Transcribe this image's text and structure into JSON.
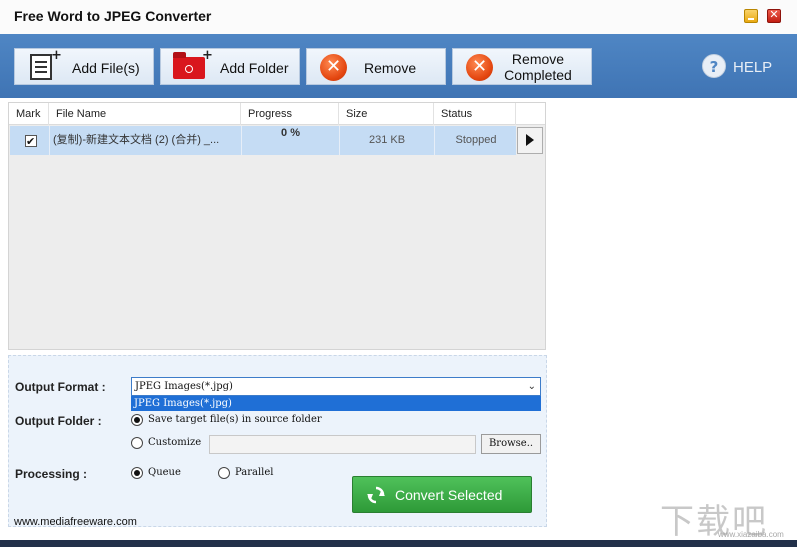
{
  "window": {
    "title": "Free Word to JPEG Converter",
    "close_glyph": "✕"
  },
  "toolbar": {
    "add_files": "Add File(s)",
    "add_folder": "Add Folder",
    "remove": "Remove",
    "remove_completed_line1": "Remove",
    "remove_completed_line2": "Completed",
    "help": "HELP",
    "help_glyph": "?",
    "x_glyph": "✕",
    "plus_glyph": "+"
  },
  "list": {
    "columns": [
      "Mark",
      "File Name",
      "Progress",
      "Size",
      "Status"
    ],
    "rows": [
      {
        "checked_glyph": "✔",
        "file_name": "(复制)-新建文本文档 (2) (合并) _...",
        "progress": "0 %",
        "size": "231 KB",
        "status": "Stopped"
      }
    ]
  },
  "options": {
    "output_format_label": "Output Format :",
    "output_format_value": "JPEG Images(*.jpg)",
    "dropdown_option": "JPEG Images(*.jpg)",
    "chevron_glyph": "⌄",
    "output_folder_label": "Output Folder :",
    "save_in_source": "Save target file(s) in source folder",
    "customize": "Customize",
    "browse": "Browse..",
    "processing_label": "Processing :",
    "queue": "Queue",
    "parallel": "Parallel"
  },
  "convert_button": "Convert Selected",
  "website": "www.mediafreeware.com",
  "watermark": {
    "text": "下载吧",
    "url": "www.xiazaiba.com"
  },
  "colors": {
    "toolbar_bg": "#4f86c4",
    "row_selected": "#c5dcf4",
    "convert_green": "#3aaa45",
    "dropdown_highlight": "#1f6fd6"
  }
}
